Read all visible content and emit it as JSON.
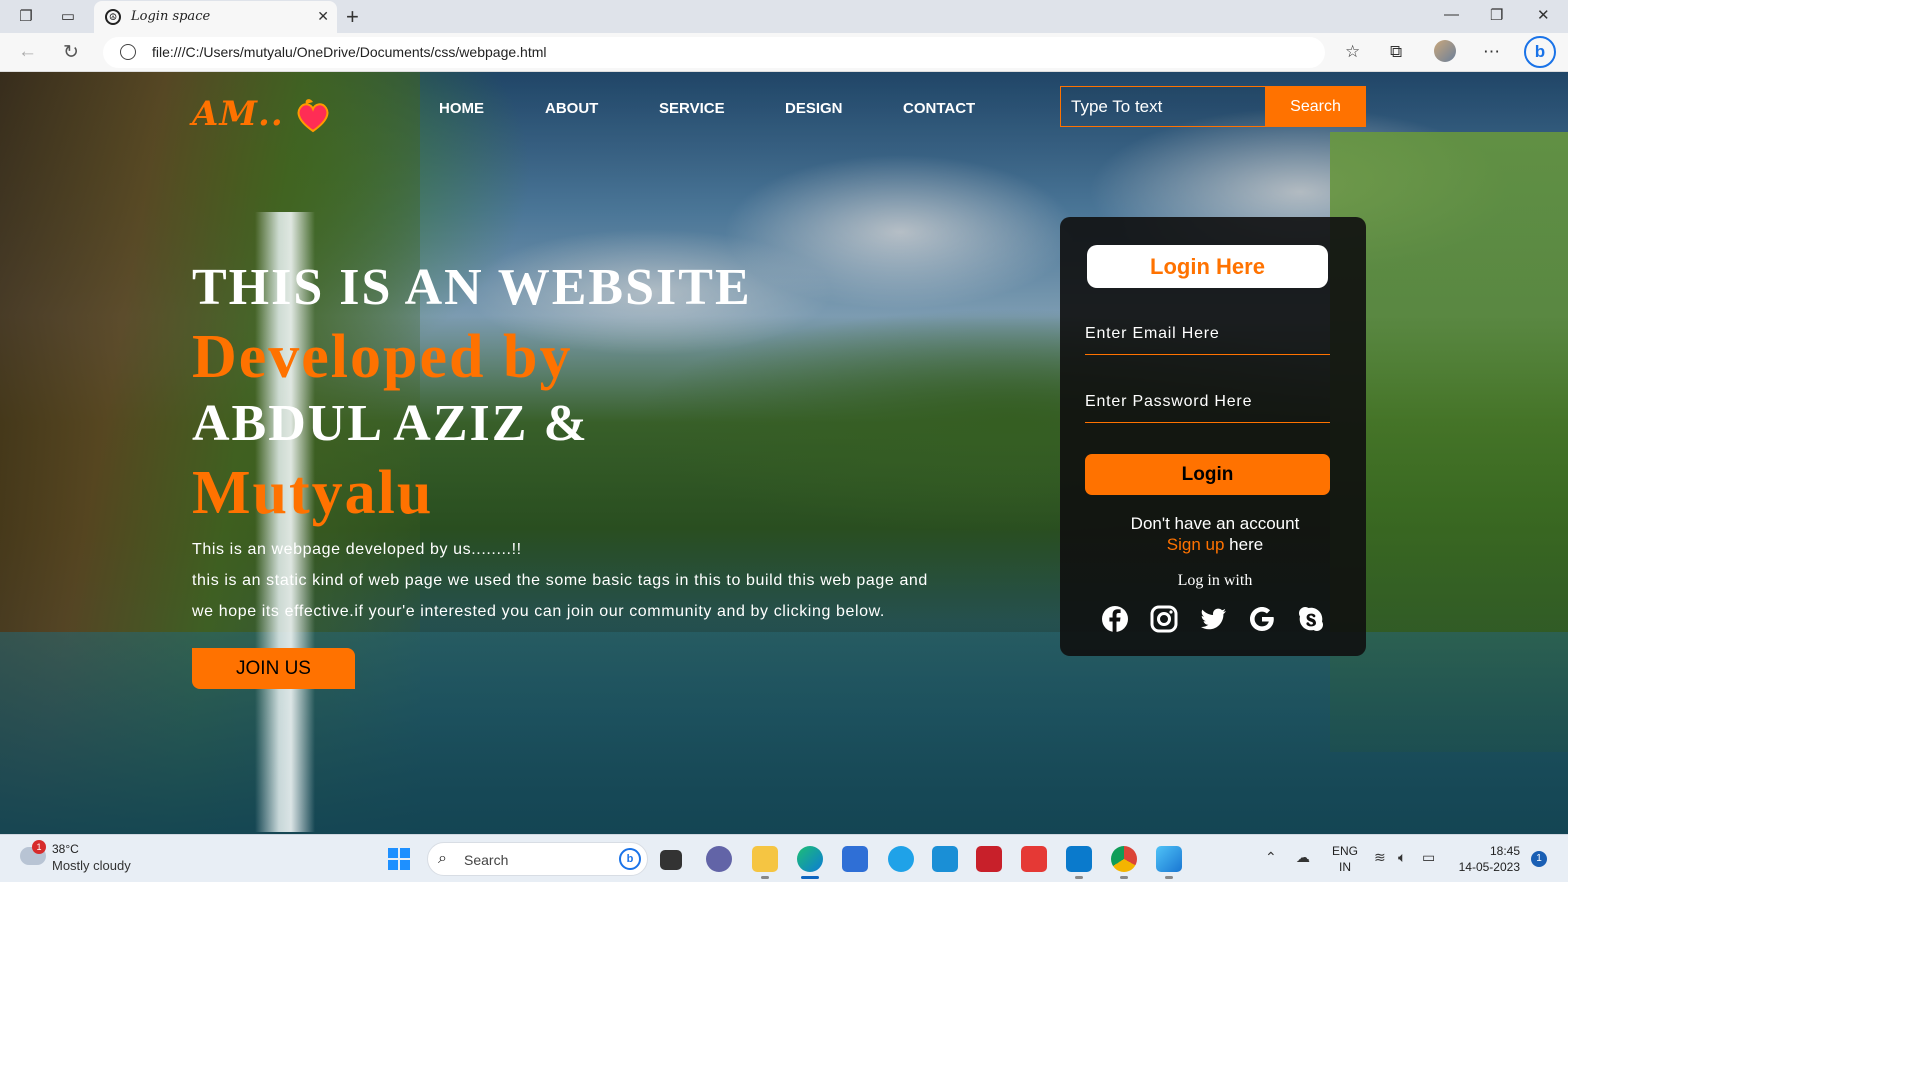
{
  "browser": {
    "tab_title": "Login space",
    "url": "file:///C:/Users/mutyalu/OneDrive/Documents/css/webpage.html"
  },
  "site": {
    "logo_text": "AM..",
    "nav": [
      "HOME",
      "ABOUT",
      "SERVICE",
      "DESIGN",
      "CONTACT"
    ],
    "search": {
      "placeholder": "Type To text",
      "button": "Search"
    },
    "accent_color": "#ff7200"
  },
  "hero": {
    "line1": "THIS IS AN WEBSITE",
    "line2": "Developed by",
    "line3": "ABDUL AZIZ &",
    "line4": "Mutyalu",
    "para1": "This is an webpage developed by us........!!",
    "para2": "this is an static kind of web page we used the some basic tags in this to build this web page and",
    "para3": "we hope its effective.if your'e interested you can join our community and by clicking below.",
    "join_button": "JOIN US"
  },
  "login": {
    "title": "Login Here",
    "email_placeholder": "Enter Email Here",
    "password_placeholder": "Enter Password Here",
    "login_button": "Login",
    "no_account": "Don't have an account",
    "signup_link": "Sign up",
    "signup_suffix": " here",
    "login_with": "Log in with",
    "social_icons": [
      "facebook-icon",
      "instagram-icon",
      "twitter-icon",
      "google-icon",
      "skype-icon"
    ]
  },
  "taskbar": {
    "weather_temp": "38°C",
    "weather_status": "Mostly cloudy",
    "weather_badge": "1",
    "search_label": "Search",
    "lang_line1": "ENG",
    "lang_line2": "IN",
    "time": "18:45",
    "date": "14-05-2023",
    "notifications": "1"
  }
}
